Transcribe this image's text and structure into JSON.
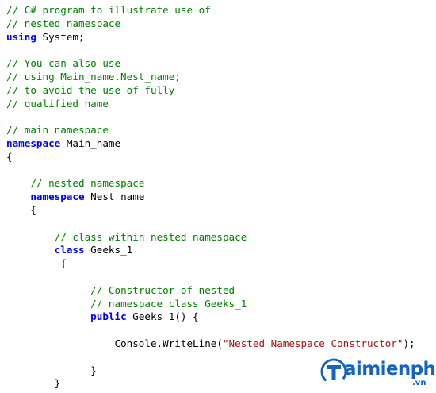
{
  "colors": {
    "comment": "#008000",
    "keyword": "#0000ff",
    "string": "#a31515",
    "plain": "#000000",
    "background": "#ffffff",
    "watermark": "#1565c0"
  },
  "code": {
    "lines": [
      [
        {
          "t": "cm",
          "v": "// C# program to illustrate use of"
        }
      ],
      [
        {
          "t": "cm",
          "v": "// nested namespace"
        }
      ],
      [
        {
          "t": "kw",
          "v": "using"
        },
        {
          "t": "pl",
          "v": " System;"
        }
      ],
      [],
      [
        {
          "t": "cm",
          "v": "// You can also use"
        }
      ],
      [
        {
          "t": "cm",
          "v": "// using Main_name.Nest_name;"
        }
      ],
      [
        {
          "t": "cm",
          "v": "// to avoid the use of fully"
        }
      ],
      [
        {
          "t": "cm",
          "v": "// qualified name"
        }
      ],
      [],
      [
        {
          "t": "cm",
          "v": "// main namespace"
        }
      ],
      [
        {
          "t": "kw",
          "v": "namespace"
        },
        {
          "t": "pl",
          "v": " Main_name"
        }
      ],
      [
        {
          "t": "pl",
          "v": "{"
        }
      ],
      [],
      [
        {
          "t": "pl",
          "v": "    "
        },
        {
          "t": "cm",
          "v": "// nested namespace"
        }
      ],
      [
        {
          "t": "pl",
          "v": "    "
        },
        {
          "t": "kw",
          "v": "namespace"
        },
        {
          "t": "pl",
          "v": " Nest_name"
        }
      ],
      [
        {
          "t": "pl",
          "v": "    {"
        }
      ],
      [],
      [
        {
          "t": "pl",
          "v": "        "
        },
        {
          "t": "cm",
          "v": "// class within nested namespace"
        }
      ],
      [
        {
          "t": "pl",
          "v": "        "
        },
        {
          "t": "kw",
          "v": "class"
        },
        {
          "t": "pl",
          "v": " Geeks_1"
        }
      ],
      [
        {
          "t": "pl",
          "v": "         {"
        }
      ],
      [],
      [
        {
          "t": "pl",
          "v": "              "
        },
        {
          "t": "cm",
          "v": "// Constructor of nested"
        }
      ],
      [
        {
          "t": "pl",
          "v": "              "
        },
        {
          "t": "cm",
          "v": "// namespace class Geeks_1"
        }
      ],
      [
        {
          "t": "pl",
          "v": "              "
        },
        {
          "t": "kw",
          "v": "public"
        },
        {
          "t": "pl",
          "v": " Geeks_1() {"
        }
      ],
      [],
      [
        {
          "t": "pl",
          "v": "                  Console.WriteLine("
        },
        {
          "t": "str",
          "v": "\"Nested Namespace Constructor\""
        },
        {
          "t": "pl",
          "v": ");"
        }
      ],
      [],
      [
        {
          "t": "pl",
          "v": "              }"
        }
      ],
      [
        {
          "t": "pl",
          "v": "        }"
        }
      ]
    ]
  },
  "watermark": {
    "logo_icon": "taimienphi-t-logo-icon",
    "text": "aimienphi",
    "suffix": ".vn"
  }
}
